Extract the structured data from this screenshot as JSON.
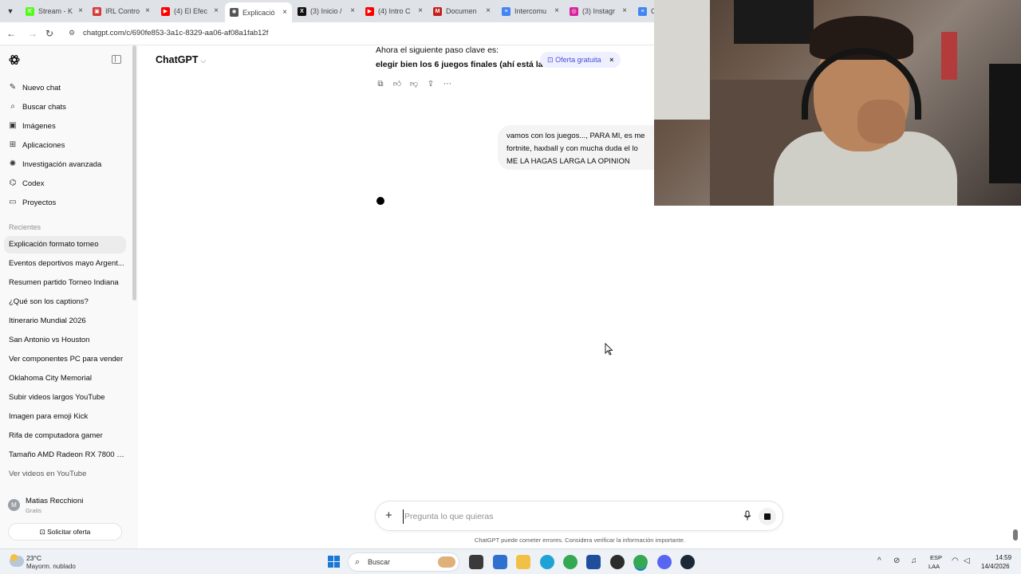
{
  "browser": {
    "tabs": [
      {
        "title": "Stream - K",
        "favicon_color": "#53fc18",
        "favicon_glyph": "K",
        "active": false
      },
      {
        "title": "IRL Contro",
        "favicon_color": "#d23a3a",
        "favicon_glyph": "▣",
        "active": false
      },
      {
        "title": "(4) El Efec",
        "favicon_color": "#ff0000",
        "favicon_glyph": "▶",
        "active": false
      },
      {
        "title": "Explicació",
        "favicon_color": "#555555",
        "favicon_glyph": "✺",
        "active": true
      },
      {
        "title": "(3) Inicio /",
        "favicon_color": "#111111",
        "favicon_glyph": "X",
        "active": false
      },
      {
        "title": "(4) Intro C",
        "favicon_color": "#ff0000",
        "favicon_glyph": "▶",
        "active": false
      },
      {
        "title": "Documen",
        "favicon_color": "#c5221f",
        "favicon_glyph": "M",
        "active": false
      },
      {
        "title": "Intercomu",
        "favicon_color": "#4285f4",
        "favicon_glyph": "≡",
        "active": false
      },
      {
        "title": "(3) Instagr",
        "favicon_color": "#d6249f",
        "favicon_glyph": "◎",
        "active": false
      },
      {
        "title": "C",
        "favicon_color": "#4285f4",
        "favicon_glyph": "≡",
        "active": false
      }
    ],
    "url": "chatgpt.com/c/690fe853-3a1c-8329-aa06-af08a1fab12f"
  },
  "sidebar": {
    "nav": [
      {
        "label": "Nuevo chat",
        "icon": "edit-icon",
        "glyph": "✎"
      },
      {
        "label": "Buscar chats",
        "icon": "search-icon",
        "glyph": "⌕"
      },
      {
        "label": "Imágenes",
        "icon": "images-icon",
        "glyph": "▣"
      },
      {
        "label": "Aplicaciones",
        "icon": "apps-icon",
        "glyph": "⊞"
      },
      {
        "label": "Investigación avanzada",
        "icon": "research-icon",
        "glyph": "✺"
      },
      {
        "label": "Codex",
        "icon": "codex-icon",
        "glyph": "⌬"
      },
      {
        "label": "Proyectos",
        "icon": "folder-icon",
        "glyph": "▭"
      }
    ],
    "recent_label": "Recientes",
    "recents": [
      "Explicación formato torneo",
      "Eventos deportivos mayo Argent...",
      "Resumen partido Torneo Indiana",
      "¿Qué son los captions?",
      "Itinerario Mundial 2026",
      "San Antonio vs Houston",
      "Ver componentes PC para vender",
      "Oklahoma City Memorial",
      "Subir videos largos YouTube",
      "Imagen para emoji Kick",
      "Rifa de computadora gamer",
      "Tamaño AMD Radeon RX 7800 XT",
      "Ver videos en YouTube"
    ],
    "user": {
      "name": "Matias Recchioni",
      "plan": "Gratis",
      "initial": "M"
    },
    "offer_button": "Solicitar oferta"
  },
  "main": {
    "model_name": "ChatGPT",
    "response_line1": "Ahora el siguiente paso clave es:",
    "response_line2": "elegir bien los 6 juegos finales (ahí está la c",
    "offer_pill": "Oferta gratuita",
    "user_message_lines": [
      "vamos con los juegos..., PARA MI, es me",
      "fortnite, haxball y con mucha duda el lo",
      "ME LA HAGAS LARGA LA OPINION"
    ],
    "composer_placeholder": "Pregunta lo que quieras",
    "disclaimer": "ChatGPT puede cometer errores. Considera verificar la información importante."
  },
  "taskbar": {
    "temperature": "23°C",
    "condition": "Mayorm. nublado",
    "search_label": "Buscar",
    "lang_top": "ESP",
    "lang_bottom": "LAA",
    "time": "14:59",
    "date": "14/4/2026"
  },
  "colors": {
    "accent_pill_bg": "#eef0ff",
    "accent_pill_text": "#4b4fd6",
    "sidebar_bg": "#f9f9f9",
    "taskbar_bg": "#eef2f7"
  }
}
